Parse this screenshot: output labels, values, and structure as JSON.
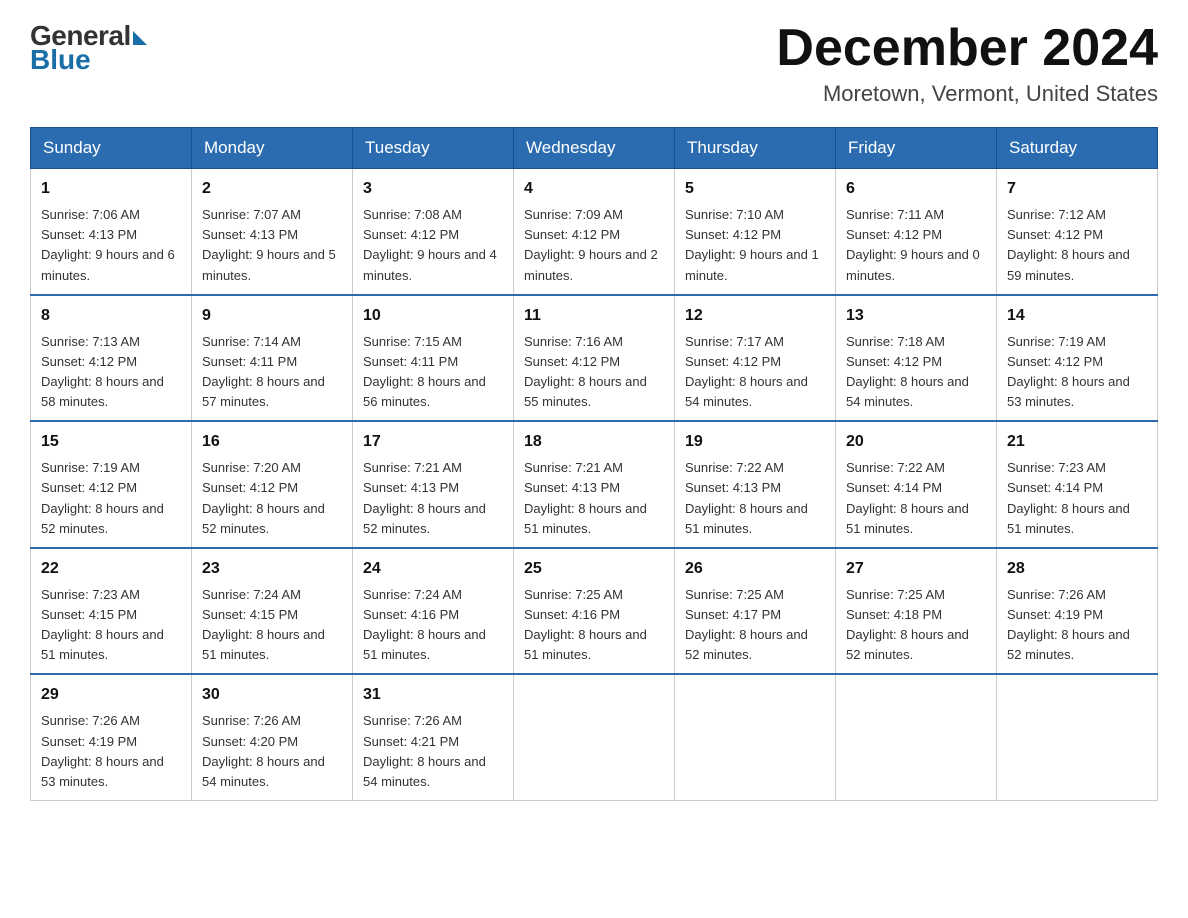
{
  "logo": {
    "general": "General",
    "blue": "Blue"
  },
  "title": "December 2024",
  "location": "Moretown, Vermont, United States",
  "days_of_week": [
    "Sunday",
    "Monday",
    "Tuesday",
    "Wednesday",
    "Thursday",
    "Friday",
    "Saturday"
  ],
  "weeks": [
    [
      {
        "day": "1",
        "sunrise": "7:06 AM",
        "sunset": "4:13 PM",
        "daylight": "9 hours and 6 minutes."
      },
      {
        "day": "2",
        "sunrise": "7:07 AM",
        "sunset": "4:13 PM",
        "daylight": "9 hours and 5 minutes."
      },
      {
        "day": "3",
        "sunrise": "7:08 AM",
        "sunset": "4:12 PM",
        "daylight": "9 hours and 4 minutes."
      },
      {
        "day": "4",
        "sunrise": "7:09 AM",
        "sunset": "4:12 PM",
        "daylight": "9 hours and 2 minutes."
      },
      {
        "day": "5",
        "sunrise": "7:10 AM",
        "sunset": "4:12 PM",
        "daylight": "9 hours and 1 minute."
      },
      {
        "day": "6",
        "sunrise": "7:11 AM",
        "sunset": "4:12 PM",
        "daylight": "9 hours and 0 minutes."
      },
      {
        "day": "7",
        "sunrise": "7:12 AM",
        "sunset": "4:12 PM",
        "daylight": "8 hours and 59 minutes."
      }
    ],
    [
      {
        "day": "8",
        "sunrise": "7:13 AM",
        "sunset": "4:12 PM",
        "daylight": "8 hours and 58 minutes."
      },
      {
        "day": "9",
        "sunrise": "7:14 AM",
        "sunset": "4:11 PM",
        "daylight": "8 hours and 57 minutes."
      },
      {
        "day": "10",
        "sunrise": "7:15 AM",
        "sunset": "4:11 PM",
        "daylight": "8 hours and 56 minutes."
      },
      {
        "day": "11",
        "sunrise": "7:16 AM",
        "sunset": "4:12 PM",
        "daylight": "8 hours and 55 minutes."
      },
      {
        "day": "12",
        "sunrise": "7:17 AM",
        "sunset": "4:12 PM",
        "daylight": "8 hours and 54 minutes."
      },
      {
        "day": "13",
        "sunrise": "7:18 AM",
        "sunset": "4:12 PM",
        "daylight": "8 hours and 54 minutes."
      },
      {
        "day": "14",
        "sunrise": "7:19 AM",
        "sunset": "4:12 PM",
        "daylight": "8 hours and 53 minutes."
      }
    ],
    [
      {
        "day": "15",
        "sunrise": "7:19 AM",
        "sunset": "4:12 PM",
        "daylight": "8 hours and 52 minutes."
      },
      {
        "day": "16",
        "sunrise": "7:20 AM",
        "sunset": "4:12 PM",
        "daylight": "8 hours and 52 minutes."
      },
      {
        "day": "17",
        "sunrise": "7:21 AM",
        "sunset": "4:13 PM",
        "daylight": "8 hours and 52 minutes."
      },
      {
        "day": "18",
        "sunrise": "7:21 AM",
        "sunset": "4:13 PM",
        "daylight": "8 hours and 51 minutes."
      },
      {
        "day": "19",
        "sunrise": "7:22 AM",
        "sunset": "4:13 PM",
        "daylight": "8 hours and 51 minutes."
      },
      {
        "day": "20",
        "sunrise": "7:22 AM",
        "sunset": "4:14 PM",
        "daylight": "8 hours and 51 minutes."
      },
      {
        "day": "21",
        "sunrise": "7:23 AM",
        "sunset": "4:14 PM",
        "daylight": "8 hours and 51 minutes."
      }
    ],
    [
      {
        "day": "22",
        "sunrise": "7:23 AM",
        "sunset": "4:15 PM",
        "daylight": "8 hours and 51 minutes."
      },
      {
        "day": "23",
        "sunrise": "7:24 AM",
        "sunset": "4:15 PM",
        "daylight": "8 hours and 51 minutes."
      },
      {
        "day": "24",
        "sunrise": "7:24 AM",
        "sunset": "4:16 PM",
        "daylight": "8 hours and 51 minutes."
      },
      {
        "day": "25",
        "sunrise": "7:25 AM",
        "sunset": "4:16 PM",
        "daylight": "8 hours and 51 minutes."
      },
      {
        "day": "26",
        "sunrise": "7:25 AM",
        "sunset": "4:17 PM",
        "daylight": "8 hours and 52 minutes."
      },
      {
        "day": "27",
        "sunrise": "7:25 AM",
        "sunset": "4:18 PM",
        "daylight": "8 hours and 52 minutes."
      },
      {
        "day": "28",
        "sunrise": "7:26 AM",
        "sunset": "4:19 PM",
        "daylight": "8 hours and 52 minutes."
      }
    ],
    [
      {
        "day": "29",
        "sunrise": "7:26 AM",
        "sunset": "4:19 PM",
        "daylight": "8 hours and 53 minutes."
      },
      {
        "day": "30",
        "sunrise": "7:26 AM",
        "sunset": "4:20 PM",
        "daylight": "8 hours and 54 minutes."
      },
      {
        "day": "31",
        "sunrise": "7:26 AM",
        "sunset": "4:21 PM",
        "daylight": "8 hours and 54 minutes."
      },
      null,
      null,
      null,
      null
    ]
  ],
  "labels": {
    "sunrise": "Sunrise:",
    "sunset": "Sunset:",
    "daylight": "Daylight:"
  }
}
